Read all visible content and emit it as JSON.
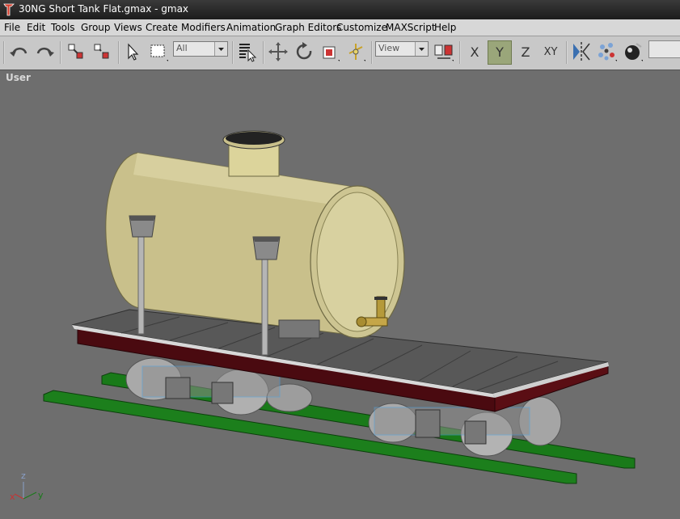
{
  "window": {
    "title": "30NG Short Tank Flat.gmax - gmax"
  },
  "menu": [
    "File",
    "Edit",
    "Tools",
    "Group",
    "Views",
    "Create",
    "Modifiers",
    "Animation",
    "Graph Editors",
    "Customize",
    "MAXScript",
    "Help"
  ],
  "toolbar": {
    "selection_filter": "All",
    "reference_coord": "View",
    "axis_x": "X",
    "axis_y": "Y",
    "axis_z": "Z",
    "axis_xy": "XY"
  },
  "viewport": {
    "label": "User",
    "gizmo_x": "x",
    "gizmo_y": "y",
    "gizmo_z": "z"
  },
  "colors": {
    "viewport_bg": "#6e6e6e",
    "tank": "#d6cf9e",
    "rails": "#1c7a1c",
    "frame": "#4a0a10",
    "deck": "#5a5a5a"
  }
}
